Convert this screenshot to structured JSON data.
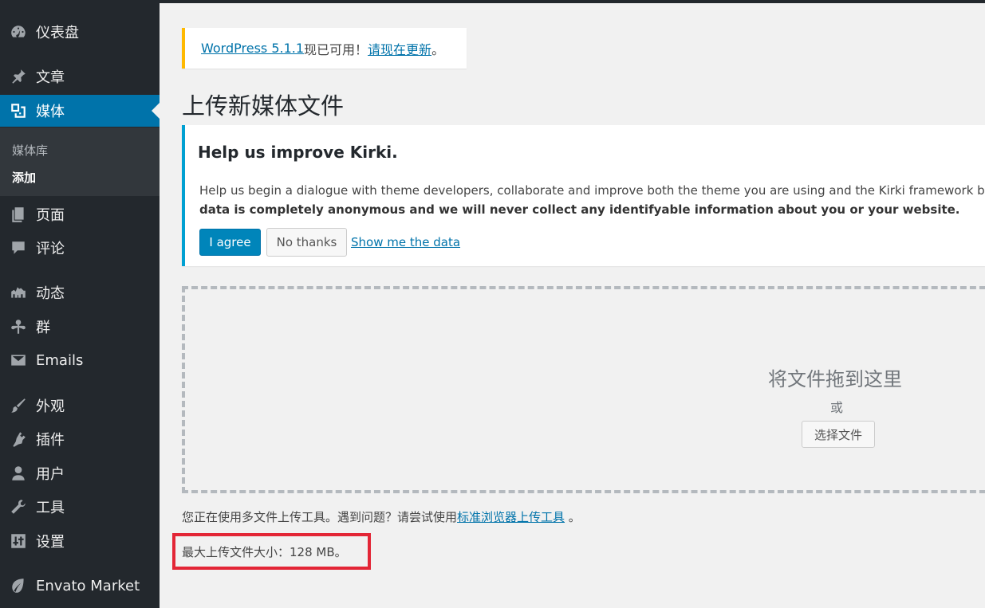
{
  "sidebar": {
    "items": [
      {
        "label": "仪表盘",
        "icon": "dashboard-icon"
      },
      {
        "label": "文章",
        "icon": "pin-icon"
      },
      {
        "label": "媒体",
        "icon": "media-icon",
        "active": true
      },
      {
        "label": "页面",
        "icon": "page-icon"
      },
      {
        "label": "评论",
        "icon": "comment-icon"
      },
      {
        "label": "动态",
        "icon": "activity-icon"
      },
      {
        "label": "群",
        "icon": "groups-icon"
      },
      {
        "label": "Emails",
        "icon": "email-icon"
      },
      {
        "label": "外观",
        "icon": "brush-icon"
      },
      {
        "label": "插件",
        "icon": "plugin-icon"
      },
      {
        "label": "用户",
        "icon": "user-icon"
      },
      {
        "label": "工具",
        "icon": "wrench-icon"
      },
      {
        "label": "设置",
        "icon": "settings-icon"
      },
      {
        "label": "Envato Market",
        "icon": "leaf-icon"
      }
    ],
    "submenu": [
      {
        "label": "媒体库"
      },
      {
        "label": "添加",
        "current": true
      }
    ]
  },
  "update_notice": {
    "version_link": "WordPress 5.1.1",
    "middle": "现已可用！",
    "update_link": "请现在更新",
    "end": "。"
  },
  "page_title": "上传新媒体文件",
  "kirki_notice": {
    "title": "Help us improve Kirki.",
    "line1": "Help us begin a dialogue with theme developers, collaborate and improve both the theme you are using and the Kirki framework by agree",
    "line2": "data is completely anonymous and we will never collect any identifyable information about you or your website.",
    "agree_label": "I agree",
    "no_thanks_label": "No thanks",
    "show_data_label": "Show me the data"
  },
  "uploader": {
    "drop_text": "将文件拖到这里",
    "or_text": "或",
    "select_label": "选择文件",
    "info_prefix": "您正在使用多文件上传工具。遇到问题？请尝试使用",
    "info_link": "标准浏览器上传工具",
    "info_suffix": " 。",
    "max_size": "最大上传文件大小：128 MB。"
  },
  "colors": {
    "sidebar_bg": "#23282d",
    "active": "#0073aa",
    "highlight_box": "#e32636"
  }
}
